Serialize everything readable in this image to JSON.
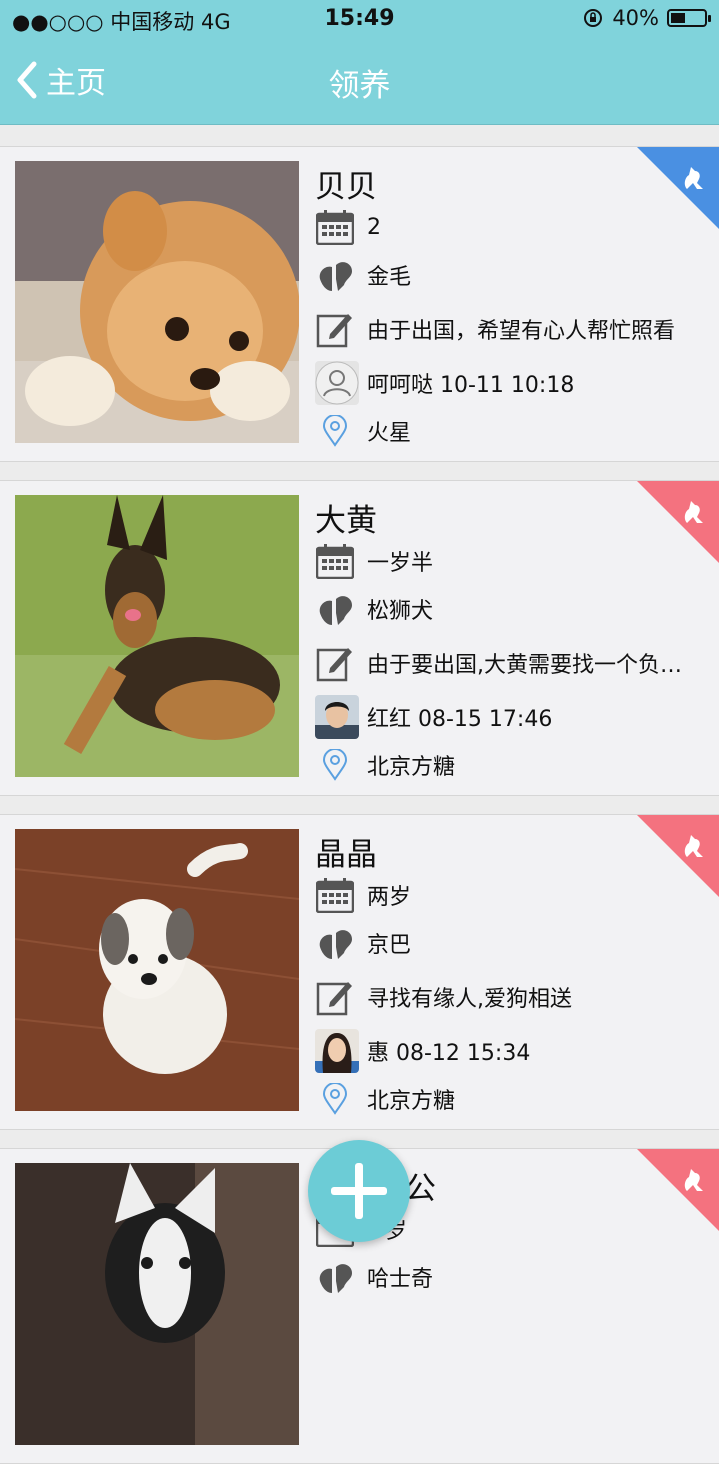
{
  "status_bar": {
    "carrier": "●●○○○ 中国移动  4G",
    "time": "15:49",
    "battery": "40%",
    "battery_level": 0.4
  },
  "nav": {
    "back_label": "主页",
    "title": "领养"
  },
  "cards": [
    {
      "name": "贝贝",
      "age": "2",
      "breed": "金毛",
      "desc": "由于出国，希望有心人帮忙照看",
      "poster": "呵呵哒 10-11 10:18",
      "location": "火星",
      "corner_color": "#4a90e2",
      "avatar_type": "default"
    },
    {
      "name": "大黄",
      "age": "一岁半",
      "breed": "松狮犬",
      "desc": "由于要出国,大黄需要找一个负…",
      "poster": "红红 08-15 17:46",
      "location": "北京方糖",
      "corner_color": "#f4727f",
      "avatar_type": "photo-male"
    },
    {
      "name": "晶晶",
      "age": "两岁",
      "breed": "京巴",
      "desc": "寻找有缘人,爱狗相送",
      "poster": "惠 08-12 15:34",
      "location": "北京方糖",
      "corner_color": "#f4727f",
      "avatar_type": "photo-female"
    },
    {
      "name": "公",
      "age": "岁",
      "breed": "哈士奇",
      "corner_color": "#f4727f"
    }
  ],
  "icons": {
    "back": "chevron-left-icon",
    "age": "calendar-icon",
    "breed": "paw-icon",
    "desc": "edit-icon",
    "location": "location-pin-icon",
    "corner": "dog-icon",
    "fab": "plus-icon"
  }
}
